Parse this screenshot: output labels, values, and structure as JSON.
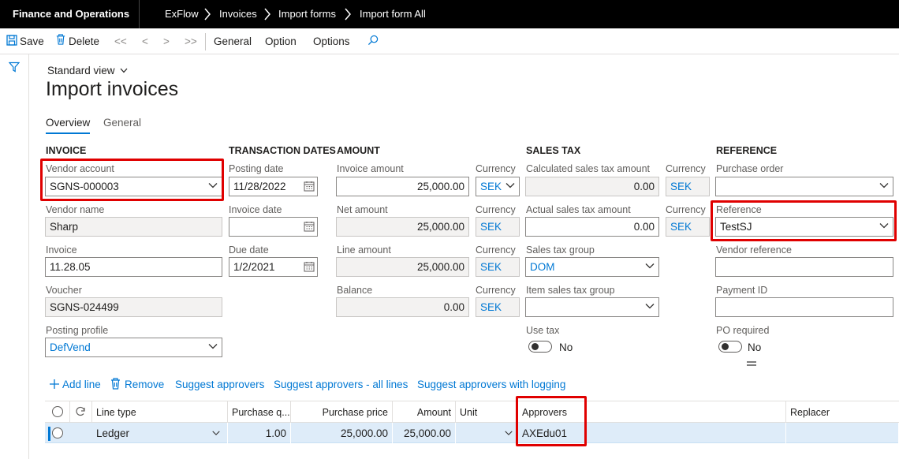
{
  "topbar": {
    "app_title": "Finance and Operations",
    "breadcrumbs": [
      "ExFlow",
      "Invoices",
      "Import forms",
      "Import form All"
    ]
  },
  "actionbar": {
    "save": "Save",
    "delete": "Delete",
    "first": "<<",
    "prev": "<",
    "next": ">",
    "last": ">>",
    "general": "General",
    "option": "Option",
    "options": "Options"
  },
  "page": {
    "view": "Standard view",
    "title": "Import invoices",
    "tabs": [
      "Overview",
      "General"
    ]
  },
  "sections": {
    "invoice": "INVOICE",
    "transaction_dates": "TRANSACTION DATES",
    "amount": "AMOUNT",
    "sales_tax": "SALES TAX",
    "reference": "REFERENCE"
  },
  "invoice": {
    "vendor_account_label": "Vendor account",
    "vendor_account": "SGNS-000003",
    "vendor_name_label": "Vendor name",
    "vendor_name": "Sharp",
    "invoice_label": "Invoice",
    "invoice": "11.28.05",
    "voucher_label": "Voucher",
    "voucher": "SGNS-024499",
    "posting_profile_label": "Posting profile",
    "posting_profile": "DefVend"
  },
  "dates": {
    "posting_date_label": "Posting date",
    "posting_date": "11/28/2022",
    "invoice_date_label": "Invoice date",
    "invoice_date": "",
    "due_date_label": "Due date",
    "due_date": "1/2/2021"
  },
  "amount": {
    "invoice_amount_label": "Invoice amount",
    "invoice_amount": "25,000.00",
    "net_amount_label": "Net amount",
    "net_amount": "25,000.00",
    "line_amount_label": "Line amount",
    "line_amount": "25,000.00",
    "balance_label": "Balance",
    "balance": "0.00",
    "currency_label": "Currency",
    "currency": "SEK"
  },
  "sales_tax": {
    "calc_label": "Calculated sales tax amount",
    "calc": "0.00",
    "actual_label": "Actual sales tax amount",
    "actual": "0.00",
    "group_label": "Sales tax group",
    "group": "DOM",
    "item_group_label": "Item sales tax group",
    "item_group": "",
    "use_tax_label": "Use tax",
    "use_tax": "No",
    "currency_label": "Currency",
    "currency": "SEK"
  },
  "reference": {
    "po_label": "Purchase order",
    "po": "",
    "ref_label": "Reference",
    "ref": "TestSJ",
    "vendor_ref_label": "Vendor reference",
    "vendor_ref": "",
    "payment_id_label": "Payment ID",
    "payment_id": "",
    "po_required_label": "PO required",
    "po_required": "No"
  },
  "line_actions": {
    "add": "Add line",
    "remove": "Remove",
    "suggest": "Suggest approvers",
    "suggest_all": "Suggest approvers - all lines",
    "suggest_log": "Suggest approvers with logging"
  },
  "grid": {
    "headers": {
      "line_type": "Line type",
      "purchase_qty": "Purchase q...",
      "purchase_price": "Purchase price",
      "amount": "Amount",
      "unit": "Unit",
      "approvers": "Approvers",
      "replacer": "Replacer"
    },
    "row": {
      "line_type": "Ledger",
      "purchase_qty": "1.00",
      "purchase_price": "25,000.00",
      "amount": "25,000.00",
      "unit": "",
      "approvers": "AXEdu01",
      "replacer": ""
    }
  },
  "colors": {
    "accent": "#0078d4",
    "highlight": "#e00000",
    "topbar": "#000000",
    "row_selected": "#deecf9"
  }
}
